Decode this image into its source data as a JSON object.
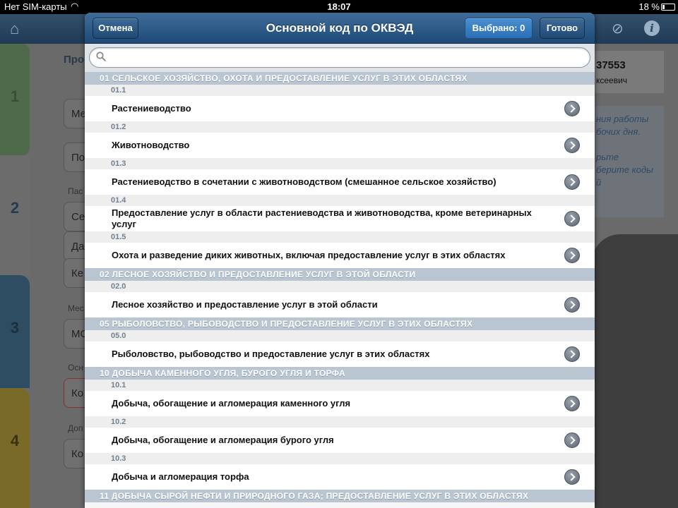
{
  "status_bar": {
    "carrier": "Нет SIM-карты",
    "time": "18:07",
    "battery": "18 %"
  },
  "background": {
    "steps": [
      "1",
      "2",
      "3",
      "4"
    ],
    "left_title_fragment": "Про",
    "left_fields": [
      "Ме",
      "По",
      "Се",
      "Да",
      "Ке",
      "МС",
      "Ко",
      "Ко"
    ],
    "left_small_labels": [
      "Пас",
      "Мес",
      "Осн",
      "Доп"
    ],
    "right_card_number": "37553",
    "right_card_name": "ксеевич",
    "right_note": "ния работы\nбочих дня.\n\nрьте\nберите коды\nй"
  },
  "popover": {
    "title": "Основной код по ОКВЭД",
    "cancel_label": "Отмена",
    "selected_label": "Выбрано: 0",
    "done_label": "Готово",
    "search_placeholder": ""
  },
  "list": [
    {
      "section": "01 СЕЛЬСКОЕ ХОЗЯЙСТВО, ОХОТА И ПРЕДОСТАВЛЕНИЕ УСЛУГ В ЭТИХ  ОБЛАСТЯХ",
      "items": [
        {
          "code": "01.1",
          "label": "Растениеводство"
        },
        {
          "code": "01.2",
          "label": "Животноводство"
        },
        {
          "code": "01.3",
          "label": "Растениеводство в сочетании с животноводством (смешанное сельское  хозяйство)"
        },
        {
          "code": "01.4",
          "label": "Предоставление услуг в области растениеводства и животноводства, кроме  ветеринарных услуг"
        },
        {
          "code": "01.5",
          "label": "Охота и разведение диких животных, включая предоставление услуг в этих  областях"
        }
      ]
    },
    {
      "section": "02 ЛЕСНОЕ ХОЗЯЙСТВО И ПРЕДОСТАВЛЕНИЕ УСЛУГ В ЭТОЙ ОБЛАСТИ",
      "items": [
        {
          "code": "02.0",
          "label": "Лесное хозяйство и предоставление услуг в этой области"
        }
      ]
    },
    {
      "section": "05 РЫБОЛОВСТВО, РЫБОВОДСТВО И ПРЕДОСТАВЛЕНИЕ УСЛУГ В ЭТИХ  ОБЛАСТЯХ",
      "items": [
        {
          "code": "05.0",
          "label": "Рыболовство, рыбоводство и предоставление услуг в этих областях"
        }
      ]
    },
    {
      "section": "10 ДОБЫЧА КАМЕННОГО УГЛЯ, БУРОГО УГЛЯ И ТОРФА",
      "items": [
        {
          "code": "10.1",
          "label": "Добыча, обогащение и агломерация каменного угля"
        },
        {
          "code": "10.2",
          "label": "Добыча, обогащение и агломерация бурого угля"
        },
        {
          "code": "10.3",
          "label": "Добыча и агломерация торфа"
        }
      ]
    },
    {
      "section": "11 ДОБЫЧА СЫРОЙ НЕФТИ И ПРИРОДНОГО ГАЗА; ПРЕДОСТАВЛЕНИЕ УСЛУГ В  ЭТИХ ОБЛАСТЯХ",
      "items": []
    }
  ],
  "colors": {
    "header_blue": "#2c5a88",
    "section_bg": "#b9c6d1",
    "code_text": "#6f8294"
  }
}
